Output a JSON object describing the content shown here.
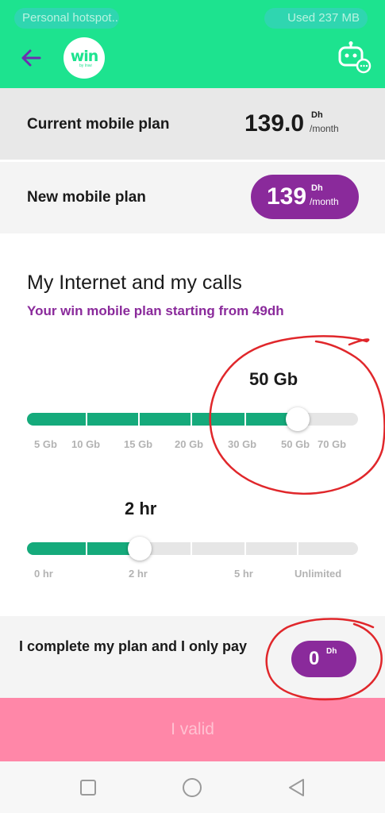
{
  "status_bar": {
    "hotspot": "Personal hotspot...",
    "used": "Used  237 MB"
  },
  "header": {
    "back_icon": "arrow-left-icon",
    "logo_text": "win",
    "logo_sub": "by Inwi",
    "assistant_icon": "robot-chat-icon"
  },
  "colors": {
    "brand_green": "#1de38f",
    "accent_purple": "#8a2a9b",
    "slider_green": "#15aa7b",
    "cta_pink": "#ff87a8"
  },
  "current_plan": {
    "label": "Current mobile plan",
    "price": "139.0",
    "currency": "Dh",
    "period": "/month"
  },
  "new_plan": {
    "label": "New mobile plan",
    "price": "139",
    "currency": "Dh",
    "period": "/month"
  },
  "section": {
    "title": "My Internet and my calls",
    "subtitle": "Your win mobile plan starting from 49dh"
  },
  "data_slider": {
    "value": "50 Gb",
    "ticks": [
      "5 Gb",
      "10 Gb",
      "15 Gb",
      "20 Gb",
      "30 Gb",
      "50 Gb",
      "70 Gb"
    ],
    "selected_index": 5
  },
  "calls_slider": {
    "value": "2 hr",
    "ticks": [
      "0 hr",
      "2 hr",
      "5 hr",
      "Unlimited"
    ],
    "selected_index": 1
  },
  "pay": {
    "label": "I complete my plan and I only pay",
    "amount": "0",
    "currency": "Dh"
  },
  "cta": {
    "label": "I valid"
  }
}
